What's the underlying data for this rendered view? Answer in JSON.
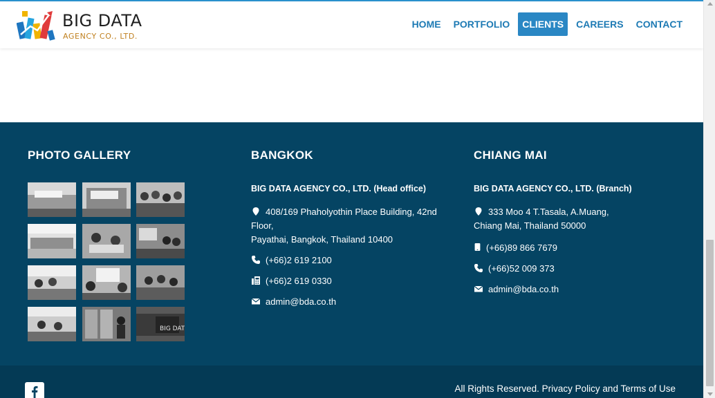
{
  "brand": {
    "title": "BIG DATA",
    "subtitle": "AGENCY CO., LTD."
  },
  "nav": {
    "items": [
      {
        "label": "HOME"
      },
      {
        "label": "PORTFOLIO"
      },
      {
        "label": "CLIENTS",
        "active": true
      },
      {
        "label": "CAREERS"
      },
      {
        "label": "CONTACT"
      }
    ]
  },
  "footer": {
    "gallery": {
      "title": "PHOTO GALLERY"
    },
    "bangkok": {
      "title": "BANGKOK",
      "company": "BIG DATA AGENCY CO., LTD. (Head office)",
      "address_line1": "408/169 Phaholyothin Place Building, 42nd",
      "address_line2": "Floor,",
      "address_line3": "Payathai, Bangkok, Thailand 10400",
      "phone": "(+66)2 619 2100",
      "fax": "(+66)2 619 0330",
      "email": "admin@bda.co.th"
    },
    "chiangmai": {
      "title": "CHIANG MAI",
      "company": "BIG DATA AGENCY CO., LTD. (Branch)",
      "address_line1": "333 Moo 4 T.Tasala, A.Muang,",
      "address_line2": "Chiang Mai, Thailand 50000",
      "mobile": "(+66)89 866 7679",
      "phone": "(+66)52 009 373",
      "email": "admin@bda.co.th"
    },
    "bottom": {
      "rights": "All Rights Reserved.",
      "privacy": "Privacy Policy",
      "and": "and",
      "terms": "Terms of Use"
    }
  },
  "colors": {
    "accent": "#2a87c4",
    "footer_bg": "#054463",
    "footer_bottom_bg": "#043a55"
  },
  "icons": [
    "logo-mark",
    "map-marker-icon",
    "phone-icon",
    "fax-icon",
    "envelope-icon",
    "mobile-icon",
    "facebook-icon"
  ]
}
